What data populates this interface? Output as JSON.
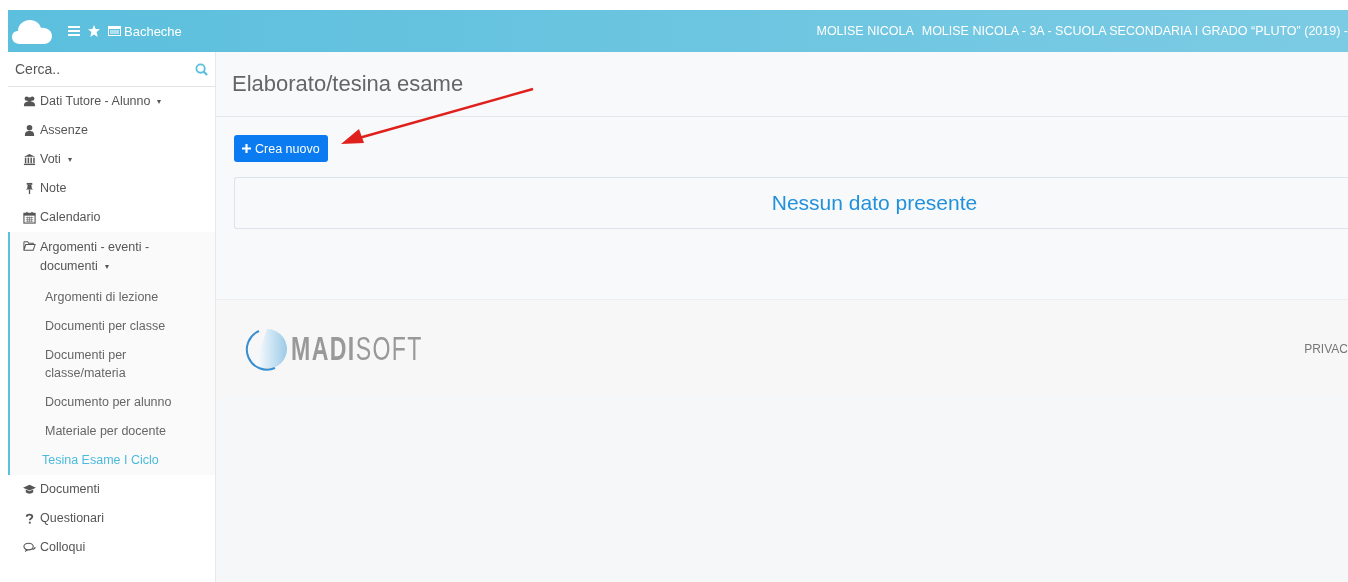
{
  "header": {
    "menu_label": "Bacheche",
    "user": "MOLISE NICOLA",
    "context": "MOLISE NICOLA - 3A - SCUOLA SECONDARIA I GRADO “PLUTO” (2019) -"
  },
  "sidebar": {
    "search": {
      "placeholder": "Cerca.."
    },
    "items": [
      {
        "label": "Dati Tutore - Alunno",
        "expanded": false
      },
      {
        "label": "Assenze"
      },
      {
        "label": "Voti",
        "expanded": false
      },
      {
        "label": "Note"
      },
      {
        "label": "Calendario"
      },
      {
        "label": "Argomenti - eventi - documenti",
        "expanded": true,
        "children": [
          {
            "label": "Argomenti di lezione",
            "selected": false
          },
          {
            "label": "Documenti per classe",
            "selected": false
          },
          {
            "label": "Documenti per classe/materia",
            "selected": false
          },
          {
            "label": "Documento per alunno",
            "selected": false
          },
          {
            "label": "Materiale per docente",
            "selected": false
          },
          {
            "label": "Tesina Esame I Ciclo",
            "selected": true
          }
        ]
      },
      {
        "label": "Documenti"
      },
      {
        "label": "Questionari"
      },
      {
        "label": "Colloqui"
      }
    ]
  },
  "page": {
    "title": "Elaborato/tesina esame",
    "create_button": "Crea nuovo",
    "empty_message": "Nessun dato presente"
  },
  "footer": {
    "logo": "**MADI**SOFT",
    "privacy": "PRIVAC"
  }
}
